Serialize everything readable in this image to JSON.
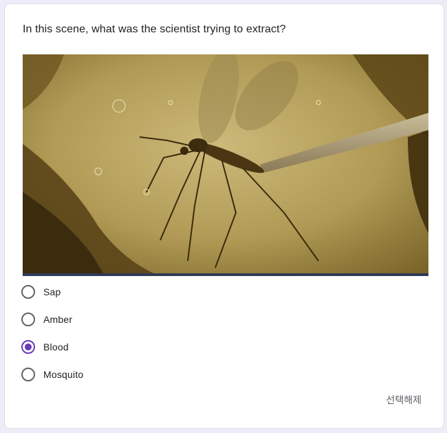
{
  "question": {
    "text": "In this scene, what was the scientist trying to extract?"
  },
  "options": [
    {
      "label": "Sap",
      "selected": false
    },
    {
      "label": "Amber",
      "selected": false
    },
    {
      "label": "Blood",
      "selected": true
    },
    {
      "label": "Mosquito",
      "selected": false
    }
  ],
  "clear_selection_label": "선택해제",
  "image": {
    "subject": "mosquito trapped in amber with a needle"
  },
  "colors": {
    "accent": "#673ab7",
    "page_background": "#f0ebf8",
    "radio_border": "#5f6368"
  }
}
